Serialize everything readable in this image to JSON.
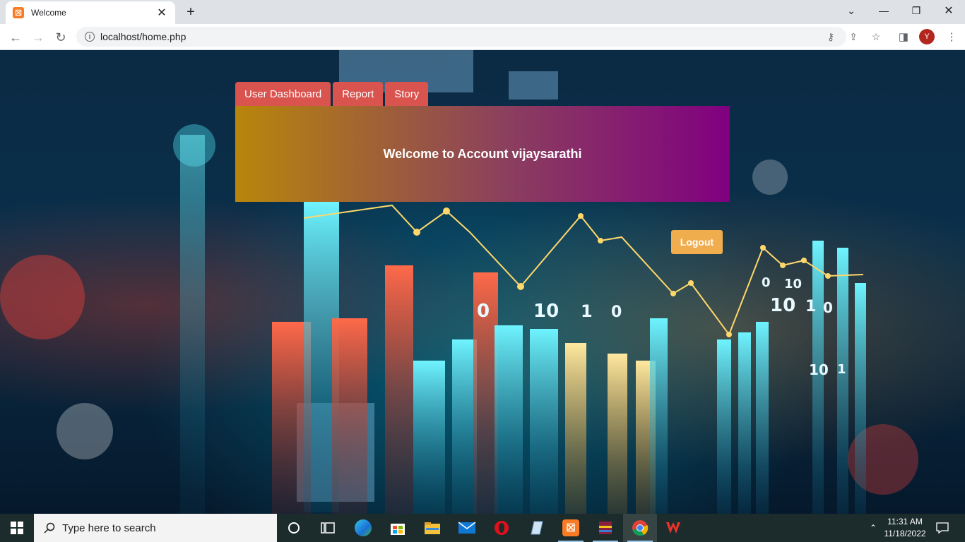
{
  "browser": {
    "tab_title": "Welcome",
    "url": "localhost/home.php",
    "profile_initial": "Y"
  },
  "page": {
    "nav_tabs": [
      "User Dashboard",
      "Report",
      "Story"
    ],
    "welcome_text": "Welcome to Account vijaysarathi",
    "logout_label": "Logout",
    "colors": {
      "tab_bg": "#d9534f",
      "gradient_start": "#b8860b",
      "gradient_end": "#800080",
      "logout_bg": "#f0ad4e"
    }
  },
  "taskbar": {
    "search_placeholder": "Type here to search",
    "time": "11:31 AM",
    "date": "11/18/2022",
    "apps": [
      "cortana-icon",
      "task-view-icon",
      "edge-icon",
      "store-icon",
      "file-explorer-icon",
      "mail-icon",
      "opera-icon",
      "notepad-icon",
      "xampp-icon",
      "winrar-icon",
      "chrome-icon",
      "wps-icon"
    ]
  }
}
